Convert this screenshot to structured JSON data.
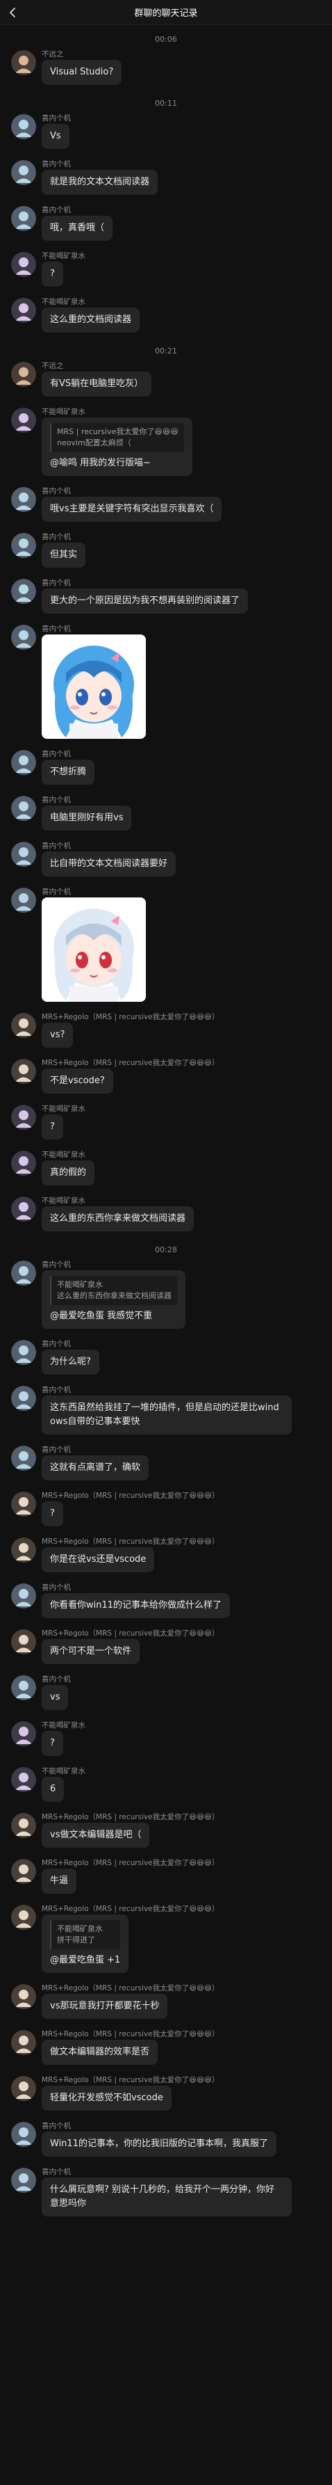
{
  "header": {
    "title": "群聊的聊天记录"
  },
  "colors": {
    "background": "#111111",
    "bubble": "#262626",
    "quote_bg": "#1b1b1b",
    "name_text": "#8e8e8e"
  },
  "icons": {
    "back": "chevron-left-icon",
    "sticker": "blue-hair-anime-girl-sticker"
  },
  "avatars": {
    "A": {
      "bg": "#4a3d35",
      "fg": "#d9b89c"
    },
    "B": {
      "bg": "#55606e",
      "fg": "#b8d8e8"
    },
    "C": {
      "bg": "#3e3a48",
      "fg": "#d8c8e8"
    },
    "D": {
      "bg": "#4a4038",
      "fg": "#e8d8c8"
    },
    "E": {
      "bg": "#3a3a3a",
      "fg": "#f0f0f0"
    }
  },
  "messages": [
    {
      "type": "time",
      "text": "00:06"
    },
    {
      "type": "msg",
      "avatar": "A",
      "name": "不远之",
      "text": "Visual Studio?"
    },
    {
      "type": "time",
      "text": "00:11"
    },
    {
      "type": "msg",
      "avatar": "B",
      "name": "喜内个机",
      "text": "Vs"
    },
    {
      "type": "msg",
      "avatar": "B",
      "name": "喜内个机",
      "text": "就是我的文本文档阅读器"
    },
    {
      "type": "msg",
      "avatar": "B",
      "name": "喜内个机",
      "text": "哦，真香哦（"
    },
    {
      "type": "msg",
      "avatar": "C",
      "name": "不能喝矿泉水",
      "text": "?"
    },
    {
      "type": "msg",
      "avatar": "C",
      "name": "不能喝矿泉水",
      "text": "这么重的文档阅读器"
    },
    {
      "type": "time",
      "text": "00:21"
    },
    {
      "type": "msg",
      "avatar": "A",
      "name": "不远之",
      "text": "有VS躺在电脑里吃灰）"
    },
    {
      "type": "msg",
      "avatar": "C",
      "name": "不能喝矿泉水",
      "quote": [
        "MRS | recursive我太爱你了😆😆😆",
        "neovim配置太麻烦（"
      ],
      "text": "@喻鸣 用我的发行版喵~"
    },
    {
      "type": "msg",
      "avatar": "B",
      "name": "喜内个机",
      "text": "哦vs主要是关键字符有突出显示我喜欢（"
    },
    {
      "type": "msg",
      "avatar": "B",
      "name": "喜内个机",
      "text": "但其实"
    },
    {
      "type": "msg",
      "avatar": "B",
      "name": "喜内个机",
      "text": "更大的一个原因是因为我不想再装别的阅读器了"
    },
    {
      "type": "sticker",
      "avatar": "B",
      "name": "喜内个机",
      "style": "blue"
    },
    {
      "type": "msg",
      "avatar": "B",
      "name": "喜内个机",
      "text": "不想折腾"
    },
    {
      "type": "msg",
      "avatar": "B",
      "name": "喜内个机",
      "text": "电脑里刚好有用vs"
    },
    {
      "type": "msg",
      "avatar": "B",
      "name": "喜内个机",
      "text": "比自带的文本文档阅读器要好"
    },
    {
      "type": "sticker",
      "avatar": "B",
      "name": "喜内个机",
      "style": "light"
    },
    {
      "type": "msg",
      "avatar": "D",
      "name": "MRS+Regolo（MRS | recursive我太爱你了😆😆😆）",
      "text": "vs?"
    },
    {
      "type": "msg",
      "avatar": "D",
      "name": "MRS+Regolo（MRS | recursive我太爱你了😆😆😆）",
      "text": "不是vscode?"
    },
    {
      "type": "msg",
      "avatar": "C",
      "name": "不能喝矿泉水",
      "text": "?"
    },
    {
      "type": "msg",
      "avatar": "C",
      "name": "不能喝矿泉水",
      "text": "真的假的"
    },
    {
      "type": "msg",
      "avatar": "C",
      "name": "不能喝矿泉水",
      "text": "这么重的东西你拿来做文档阅读器"
    },
    {
      "type": "time",
      "text": "00:28"
    },
    {
      "type": "msg",
      "avatar": "B",
      "name": "喜内个机",
      "quote": [
        "不能喝矿泉水",
        "这么重的东西你拿来做文档阅读器"
      ],
      "text": "@最爱吃鱼蛋 我感觉不重"
    },
    {
      "type": "msg",
      "avatar": "B",
      "name": "喜内个机",
      "text": "为什么呢?"
    },
    {
      "type": "msg",
      "avatar": "B",
      "name": "喜内个机",
      "text": "这东西虽然给我挂了一堆的插件，但是启动的还是比windows自带的记事本要快"
    },
    {
      "type": "msg",
      "avatar": "B",
      "name": "喜内个机",
      "text": "这就有点离谱了，确软"
    },
    {
      "type": "msg",
      "avatar": "D",
      "name": "MRS+Regolo（MRS | recursive我太爱你了😆😆😆）",
      "text": "?"
    },
    {
      "type": "msg",
      "avatar": "D",
      "name": "MRS+Regolo（MRS | recursive我太爱你了😆😆😆）",
      "text": "你是在说vs还是vscode"
    },
    {
      "type": "msg",
      "avatar": "B",
      "name": "喜内个机",
      "text": "你看看你win11的记事本给你做成什么样了"
    },
    {
      "type": "msg",
      "avatar": "D",
      "name": "MRS+Regolo（MRS | recursive我太爱你了😆😆😆）",
      "text": "两个可不是一个软件"
    },
    {
      "type": "msg",
      "avatar": "B",
      "name": "喜内个机",
      "text": "vs"
    },
    {
      "type": "msg",
      "avatar": "C",
      "name": "不能喝矿泉水",
      "text": "?"
    },
    {
      "type": "msg",
      "avatar": "C",
      "name": "不能喝矿泉水",
      "text": "6"
    },
    {
      "type": "msg",
      "avatar": "D",
      "name": "MRS+Regolo（MRS | recursive我太爱你了😆😆😆）",
      "text": "vs做文本编辑器是吧（"
    },
    {
      "type": "msg",
      "avatar": "D",
      "name": "MRS+Regolo（MRS | recursive我太爱你了😆😆😆）",
      "text": "牛逼"
    },
    {
      "type": "msg",
      "avatar": "D",
      "name": "MRS+Regolo（MRS | recursive我太爱你了😆😆😆）",
      "quote": [
        "不能喝矿泉水",
        "拼干得进了"
      ],
      "text": "@最爱吃鱼蛋 +1"
    },
    {
      "type": "msg",
      "avatar": "D",
      "name": "MRS+Regolo（MRS | recursive我太爱你了😆😆😆）",
      "text": "vs那玩意我打开都要花十秒"
    },
    {
      "type": "msg",
      "avatar": "D",
      "name": "MRS+Regolo（MRS | recursive我太爱你了😆😆😆）",
      "text": "做文本编辑器的效率是否"
    },
    {
      "type": "msg",
      "avatar": "D",
      "name": "MRS+Regolo（MRS | recursive我太爱你了😆😆😆）",
      "text": "轻量化开发感觉不如vscode"
    },
    {
      "type": "msg",
      "avatar": "B",
      "name": "喜内个机",
      "text": "Win11的记事本，你的比我旧版的记事本啊，我真服了"
    },
    {
      "type": "msg",
      "avatar": "B",
      "name": "喜内个机",
      "text": "什么屑玩意啊? 别说十几秒的，给我开个一两分钟，你好意思吗你"
    }
  ]
}
